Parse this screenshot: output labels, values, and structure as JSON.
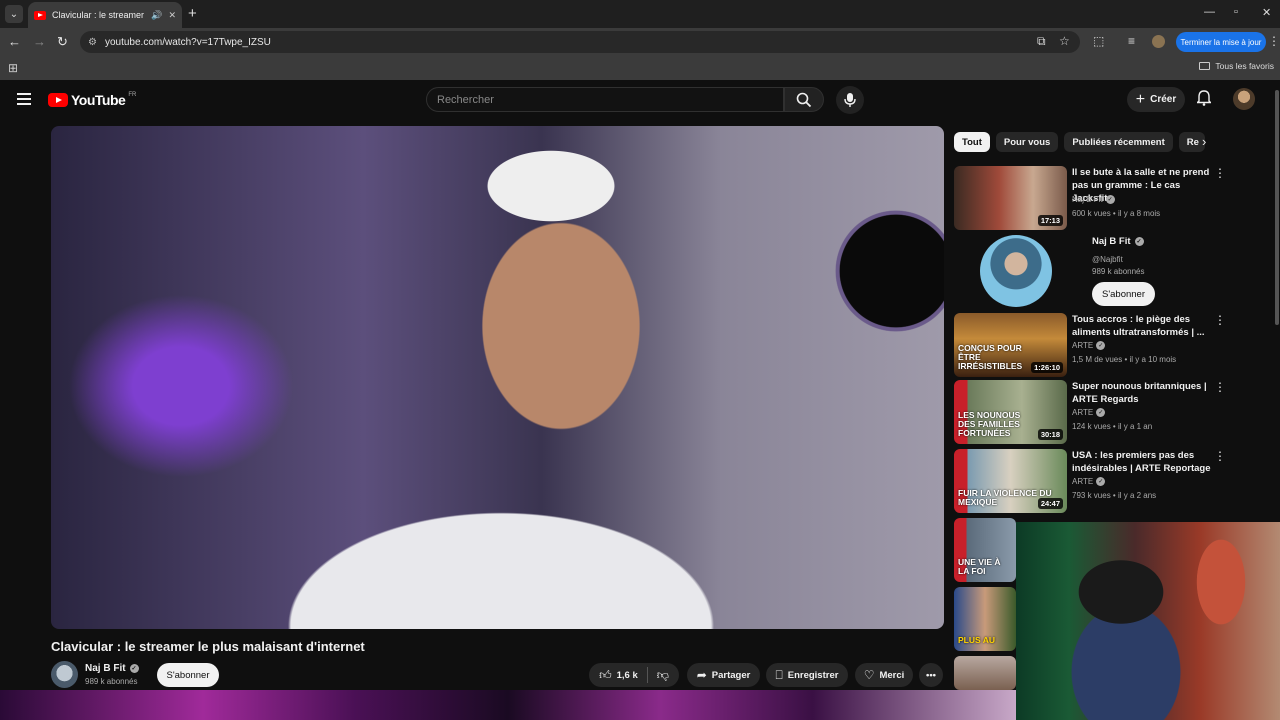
{
  "browser": {
    "tab_title": "Clavicular : le streamer le pl",
    "url": "youtube.com/watch?v=17Twpe_IZSU",
    "update_button": "Terminer la mise à jour",
    "bookmarks_all": "Tous les favoris"
  },
  "youtube": {
    "logo_text": "YouTube",
    "country_code": "FR",
    "search_placeholder": "Rechercher",
    "create_label": "Créer"
  },
  "video": {
    "title": "Clavicular : le streamer le plus malaisant d'internet",
    "channel_name": "Naj B Fit",
    "channel_subs": "989 k abonnés",
    "subscribe_label": "S'abonner",
    "likes": "1,6 k",
    "share_label": "Partager",
    "save_label": "Enregistrer",
    "thanks_label": "Merci"
  },
  "chips": [
    "Tout",
    "Pour vous",
    "Publiées récemment",
    "Re"
  ],
  "recommendations": [
    {
      "title": "Il se bute à la salle et ne prend pas un gramme : Le cas Jacksfit",
      "channel": "Naj B Fit",
      "verified": true,
      "meta": "600 k vues • il y a 8 mois",
      "duration": "17:13",
      "thumb_text": ""
    },
    {
      "title": "Tous accros : le piège des aliments ultratransformés | ...",
      "channel": "ARTE",
      "verified": true,
      "meta": "1,5 M de vues • il y a 10 mois",
      "duration": "1:26:10",
      "thumb_text": "CONÇUS POUR ÊTRE IRRÉSISTIBLES"
    },
    {
      "title": "Super nounous britanniques | ARTE Regards",
      "channel": "ARTE",
      "verified": true,
      "meta": "124 k vues • il y a 1 an",
      "duration": "30:18",
      "thumb_text": "LES NOUNOUS DES FAMILLES FORTUNÉES"
    },
    {
      "title": "USA : les premiers pas des indésirables | ARTE Reportage",
      "channel": "ARTE",
      "verified": true,
      "meta": "793 k vues • il y a 2 ans",
      "duration": "24:47",
      "thumb_text": "FUIR LA VIOLENCE DU MEXIQUE"
    }
  ],
  "channel_card": {
    "name": "Naj B Fit",
    "handle": "@Najbfit",
    "subs": "989 k abonnés",
    "subscribe_label": "S'abonner"
  },
  "partial_thumbs": [
    {
      "thumb_text": "UNE VIE À LA FOI"
    },
    {
      "thumb_text": "PLUS AU"
    }
  ],
  "colors": {
    "youtube_red": "#ff0000",
    "background": "#0f0f0f",
    "update_blue": "#1a73e8"
  }
}
